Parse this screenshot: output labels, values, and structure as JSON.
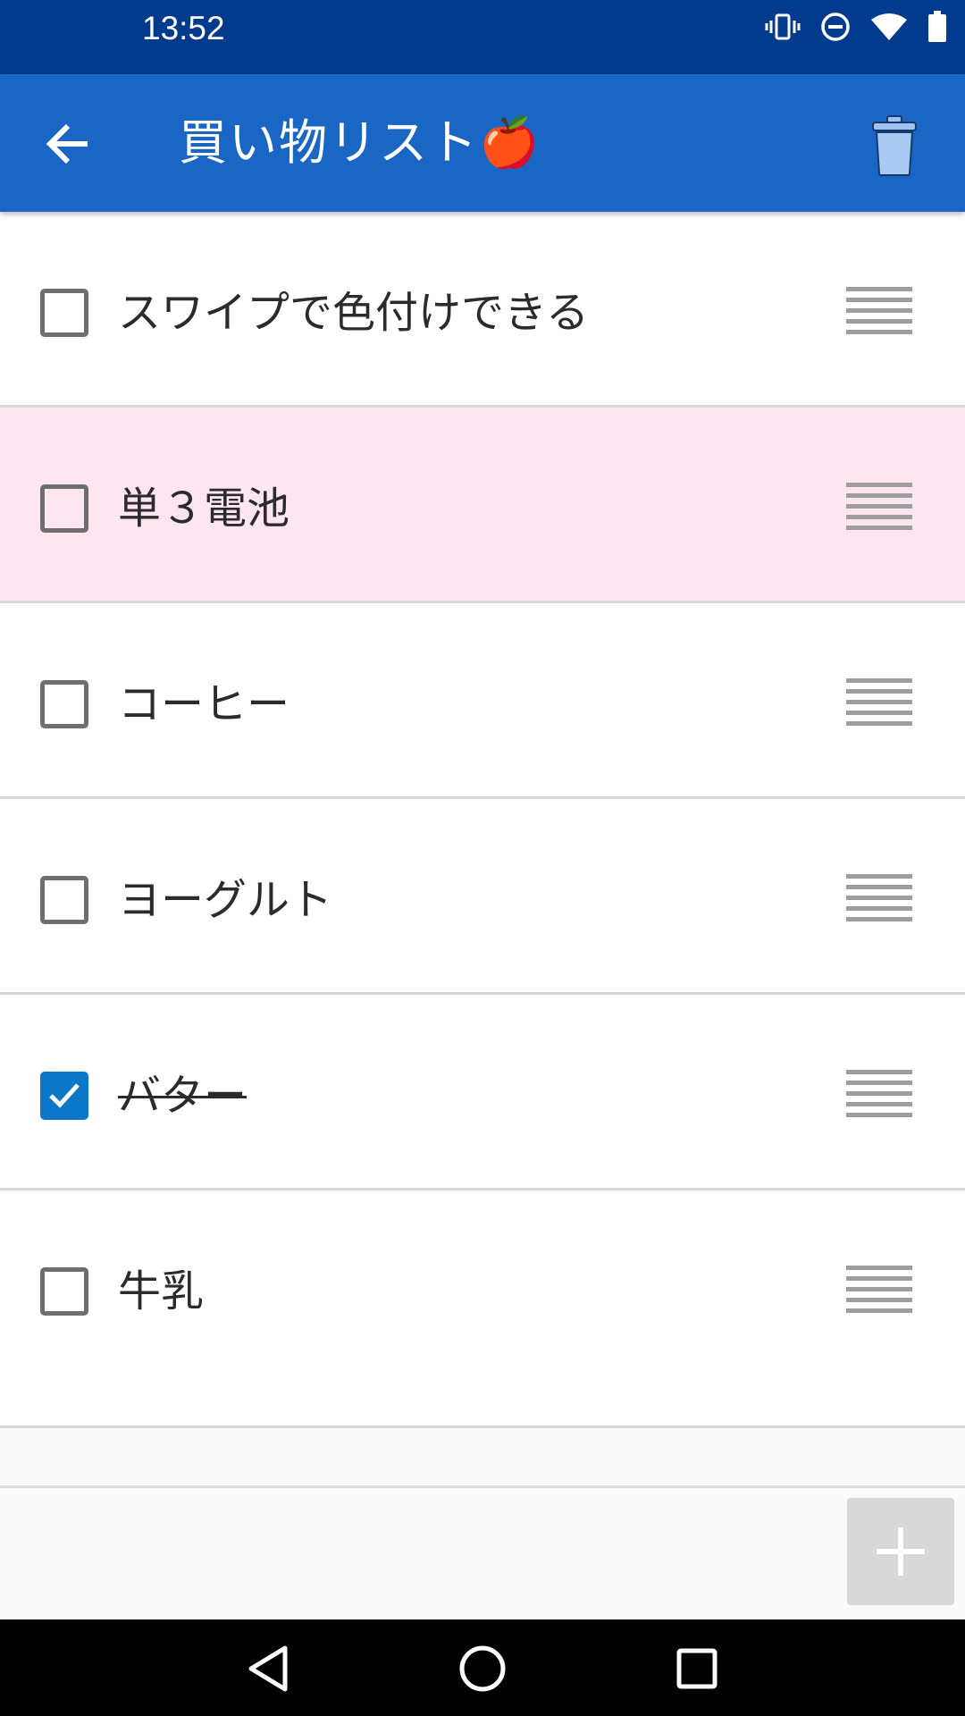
{
  "status_bar": {
    "time": "13:52",
    "icons": [
      "vibrate-icon",
      "do-not-disturb-icon",
      "wifi-icon",
      "battery-icon"
    ]
  },
  "app_bar": {
    "title": "買い物リスト🍎",
    "back_icon": "arrow-back-icon",
    "action_icon": "trash-icon",
    "background": "#1a66c4"
  },
  "list": {
    "items": [
      {
        "label": "スワイプで色付けできる",
        "checked": false,
        "highlight": "none"
      },
      {
        "label": "単３電池",
        "checked": false,
        "highlight": "#fde6f0"
      },
      {
        "label": "コーヒー",
        "checked": false,
        "highlight": "none"
      },
      {
        "label": "ヨーグルト",
        "checked": false,
        "highlight": "none"
      },
      {
        "label": "バター",
        "checked": true,
        "highlight": "none"
      },
      {
        "label": "牛乳",
        "checked": false,
        "highlight": "none"
      }
    ]
  },
  "add_button": {
    "icon": "plus-icon"
  },
  "nav_bar": {
    "icons": [
      "back-triangle-icon",
      "home-circle-icon",
      "recents-square-icon"
    ]
  }
}
